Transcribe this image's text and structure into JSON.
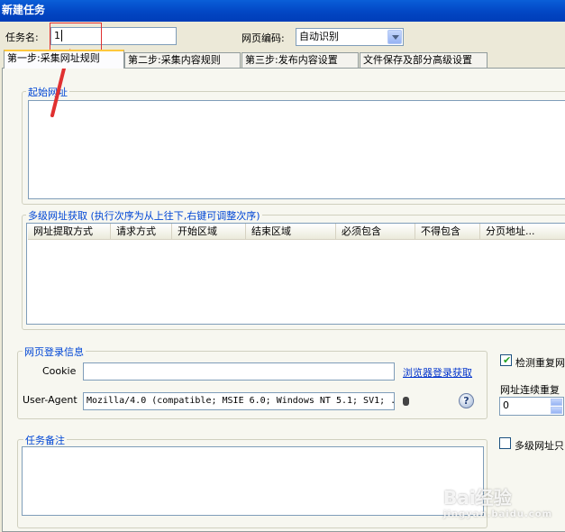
{
  "window": {
    "title": "新建任务"
  },
  "form": {
    "task_name_label": "任务名:",
    "task_name_value": "1",
    "encoding_label": "网页编码:",
    "encoding_value": "自动识别"
  },
  "tabs": [
    {
      "label": "第一步:采集网址规则",
      "active": true
    },
    {
      "label": "第二步:采集内容规则",
      "active": false
    },
    {
      "label": "第三步:发布内容设置",
      "active": false
    },
    {
      "label": "文件保存及部分高级设置",
      "active": false
    }
  ],
  "start_urls": {
    "title": "起始网址"
  },
  "multi_level": {
    "title": "多级网址获取 (执行次序为从上往下,右键可调整次序)",
    "columns": [
      "网址提取方式",
      "请求方式",
      "开始区域",
      "结束区域",
      "必须包含",
      "不得包含",
      "分页地址..."
    ]
  },
  "login": {
    "title": "网页登录信息",
    "cookie_label": "Cookie",
    "cookie_value": "",
    "browser_login_link": "浏览器登录获取",
    "useragent_label": "User-Agent",
    "useragent_value": "Mozilla/4.0 (compatible; MSIE 6.0; Windows NT 5.1; SV1; ."
  },
  "options": {
    "check_duplicate_label": "检测重复网",
    "check_duplicate_checked": true,
    "consecutive_label": "网址连续重复",
    "consecutive_value": "0",
    "multi_level_only_label": "多级网址只",
    "multi_level_only_checked": false
  },
  "notes": {
    "title": "任务备注"
  },
  "watermark": {
    "text": "Bai经验",
    "sub": "jingyan.baidu.com"
  },
  "colors": {
    "titlebar": "#0A5FD8",
    "group_title": "#0046D5",
    "link": "#0033CC",
    "annotation": "#E03030"
  }
}
